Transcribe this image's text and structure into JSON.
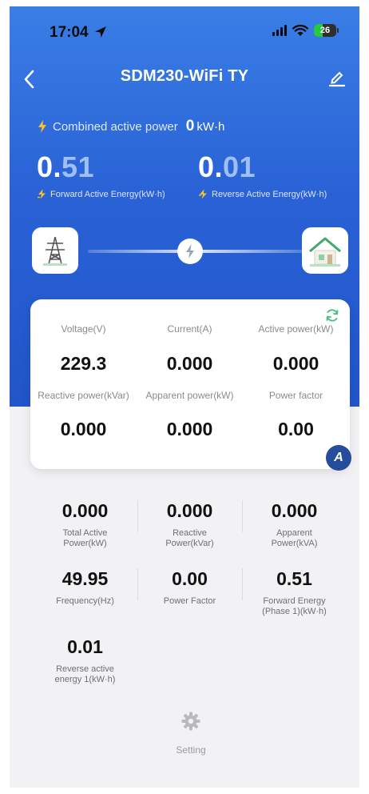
{
  "status": {
    "time": "17:04",
    "battery": "26"
  },
  "nav": {
    "title": "SDM230-WiFi TY"
  },
  "summary": {
    "combined_label": "Combined active power",
    "combined_value": "0",
    "combined_unit": "kW·h",
    "forward": {
      "int": "0.",
      "dec": "51",
      "label": "Forward Active Energy(kW·h)"
    },
    "reverse": {
      "int": "0.",
      "dec": "01",
      "label": "Reverse Active Energy(kW·h)"
    }
  },
  "card": {
    "cells": [
      {
        "label": "Voltage(V)",
        "value": "229.3"
      },
      {
        "label": "Current(A)",
        "value": "0.000"
      },
      {
        "label": "Active power(kW)",
        "value": "0.000"
      },
      {
        "label": "Reactive power(kVar)",
        "value": "0.000"
      },
      {
        "label": "Apparent power(kW)",
        "value": "0.000"
      },
      {
        "label": "Power factor",
        "value": "0.00"
      }
    ],
    "badge": "A"
  },
  "stats": [
    {
      "value": "0.000",
      "label_lines": [
        "Total Active",
        "Power(kW)"
      ]
    },
    {
      "value": "0.000",
      "label_lines": [
        "Reactive",
        "Power(kVar)"
      ]
    },
    {
      "value": "0.000",
      "label_lines": [
        "Apparent",
        "Power(kVA)"
      ]
    },
    {
      "value": "49.95",
      "label_lines": [
        "Frequency(Hz)",
        ""
      ]
    },
    {
      "value": "0.00",
      "label_lines": [
        "Power Factor",
        ""
      ]
    },
    {
      "value": "0.51",
      "label_lines": [
        "Forward Energy",
        "(Phase 1)(kW·h)"
      ]
    },
    {
      "value": "0.01",
      "label_lines": [
        "Reverse active",
        "energy 1(kW·h)"
      ]
    }
  ],
  "footer": {
    "setting_label": "Setting"
  },
  "colors": {
    "primary": "#2a63d6",
    "accent_yellow": "#f6c12b",
    "badge": "#264c9c",
    "refresh": "#43c07a"
  },
  "icons": [
    "location-arrow-icon",
    "signal-icon",
    "wifi-icon",
    "battery-icon",
    "back-chevron-icon",
    "edit-icon",
    "bolt-icon",
    "power-tower-icon",
    "house-icon",
    "refresh-icon",
    "gear-icon"
  ]
}
